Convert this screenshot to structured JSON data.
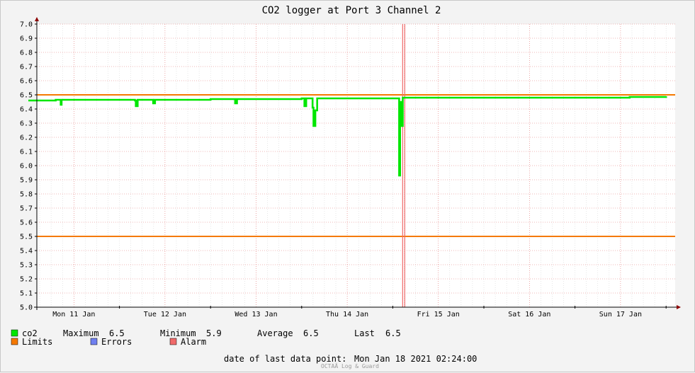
{
  "chart_data": {
    "type": "line",
    "title": "CO2 logger at Port 3 Channel 2",
    "ylim": [
      5.0,
      7.0
    ],
    "y_ticks": [
      "5.0",
      "5.1",
      "5.2",
      "5.3",
      "5.4",
      "5.5",
      "5.6",
      "5.7",
      "5.8",
      "5.9",
      "6.0",
      "6.1",
      "6.2",
      "6.3",
      "6.4",
      "6.5",
      "6.6",
      "6.7",
      "6.8",
      "6.9",
      "7.0"
    ],
    "x_ticks": [
      "Mon 11 Jan",
      "Tue 12 Jan",
      "Wed 13 Jan",
      "Thu 14 Jan",
      "Fri 15 Jan",
      "Sat 16 Jan",
      "Sun 17 Jan"
    ],
    "grid": true,
    "limits": [
      5.5,
      6.5
    ],
    "alarm_at_day": 4.12,
    "series": [
      {
        "name": "co2",
        "x_days": [
          0,
          0.3,
          0.35,
          0.355,
          0.36,
          0.365,
          0.4,
          1,
          1.15,
          1.17,
          1.18,
          1.19,
          1.2,
          1.35,
          1.37,
          1.38,
          1.39,
          1.4,
          2,
          2.25,
          2.27,
          2.28,
          2.29,
          2.3,
          3,
          3.0,
          3.02,
          3.03,
          3.04,
          3.05,
          3.1,
          3.12,
          3.13,
          3.14,
          3.15,
          3.16,
          3.17,
          3.18,
          3.19,
          3.2,
          4,
          4.06,
          4.07,
          4.075,
          4.08,
          4.09,
          4.095,
          4.1,
          4.11,
          4.2,
          5,
          5.5,
          6,
          6.6,
          7
        ],
        "values": [
          6.46,
          6.465,
          6.465,
          6.43,
          6.43,
          6.465,
          6.465,
          6.465,
          6.465,
          6.46,
          6.42,
          6.42,
          6.465,
          6.465,
          6.44,
          6.44,
          6.465,
          6.465,
          6.47,
          6.47,
          6.44,
          6.44,
          6.47,
          6.47,
          6.47,
          6.475,
          6.475,
          6.42,
          6.42,
          6.475,
          6.475,
          6.41,
          6.28,
          6.28,
          6.39,
          6.39,
          6.475,
          6.475,
          6.475,
          6.475,
          6.475,
          6.475,
          5.93,
          5.93,
          6.45,
          6.45,
          6.28,
          6.28,
          6.48,
          6.48,
          6.48,
          6.48,
          6.48,
          6.485,
          6.49
        ]
      }
    ]
  },
  "legend": {
    "co2": "co2",
    "max_label": "Maximum",
    "max_value": "6.5",
    "min_label": "Minimum",
    "min_value": "5.9",
    "avg_label": "Average",
    "avg_value": "6.5",
    "last_label": "Last",
    "last_value": "6.5",
    "limits": "Limits",
    "errors": "Errors",
    "alarm": "Alarm"
  },
  "footer": {
    "last_point_label": "date of last data point:",
    "last_point_value": "Mon Jan 18 2021 02:24:00",
    "credit": "OCTAÄ Log & Guard"
  },
  "colors": {
    "co2": "#00e600",
    "limits": "#f57900",
    "errors": "#7080f0",
    "alarm": "#f06a6a",
    "grid_major": "#e07070",
    "grid_minor": "#d8d8d8"
  }
}
